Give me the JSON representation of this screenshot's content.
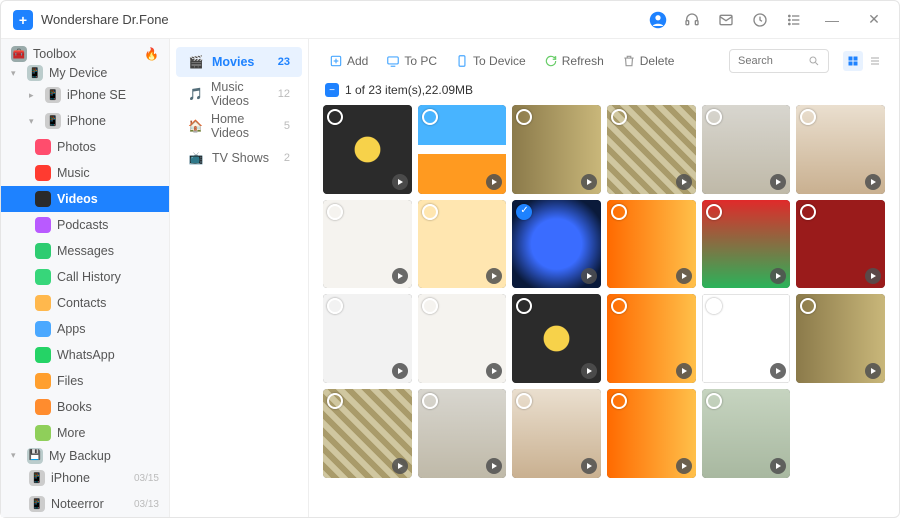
{
  "app": {
    "title": "Wondershare Dr.Fone"
  },
  "titlebar_icons": [
    "user-icon",
    "headset-icon",
    "mail-icon",
    "history-icon",
    "list-icon",
    "minimize-icon",
    "close-icon"
  ],
  "sidebar": {
    "toolbox": "Toolbox",
    "myDevice": "My Device",
    "devices": [
      {
        "name": "iPhone SE",
        "expanded": false
      },
      {
        "name": "iPhone",
        "expanded": true
      }
    ],
    "deviceItems": [
      {
        "label": "Photos",
        "icon_bg": "#ff4d6d"
      },
      {
        "label": "Music",
        "icon_bg": "#ff3b30"
      },
      {
        "label": "Videos",
        "icon_bg": "#2a2a2a",
        "active": true
      },
      {
        "label": "Podcasts",
        "icon_bg": "#b95aff"
      },
      {
        "label": "Messages",
        "icon_bg": "#2ecc71"
      },
      {
        "label": "Call History",
        "icon_bg": "#37d67a"
      },
      {
        "label": "Contacts",
        "icon_bg": "#ffb84d"
      },
      {
        "label": "Apps",
        "icon_bg": "#4aa8ff"
      },
      {
        "label": "WhatsApp",
        "icon_bg": "#25d366"
      },
      {
        "label": "Files",
        "icon_bg": "#ff9f2e"
      },
      {
        "label": "Books",
        "icon_bg": "#ff8c2e"
      },
      {
        "label": "More",
        "icon_bg": "#8fcf5a"
      }
    ],
    "myBackup": "My Backup",
    "backups": [
      {
        "label": "iPhone",
        "date": "03/15"
      },
      {
        "label": "Noteerror",
        "date": "03/13"
      }
    ]
  },
  "categories": [
    {
      "label": "Movies",
      "count": "23",
      "active": true
    },
    {
      "label": "Music Videos",
      "count": "12"
    },
    {
      "label": "Home Videos",
      "count": "5"
    },
    {
      "label": "TV Shows",
      "count": "2"
    }
  ],
  "toolbar": {
    "add": "Add",
    "toPC": "To PC",
    "toDevice": "To Device",
    "refresh": "Refresh",
    "delete": "Delete",
    "search_placeholder": "Search"
  },
  "summary": "1 of 23 item(s),22.09MB",
  "thumbs": [
    {
      "art": "a1"
    },
    {
      "art": "a2"
    },
    {
      "art": "a3"
    },
    {
      "art": "a4"
    },
    {
      "art": "a5"
    },
    {
      "art": "a6"
    },
    {
      "art": "a7"
    },
    {
      "art": "a8"
    },
    {
      "art": "a9",
      "selected": true
    },
    {
      "art": "a10"
    },
    {
      "art": "a11"
    },
    {
      "art": "a12"
    },
    {
      "art": "a13"
    },
    {
      "art": "a7"
    },
    {
      "art": "a1"
    },
    {
      "art": "a10"
    },
    {
      "art": "a14"
    },
    {
      "art": "a3"
    },
    {
      "art": "a4"
    },
    {
      "art": "a5"
    },
    {
      "art": "a6"
    },
    {
      "art": "a10"
    },
    {
      "art": "a15"
    }
  ]
}
